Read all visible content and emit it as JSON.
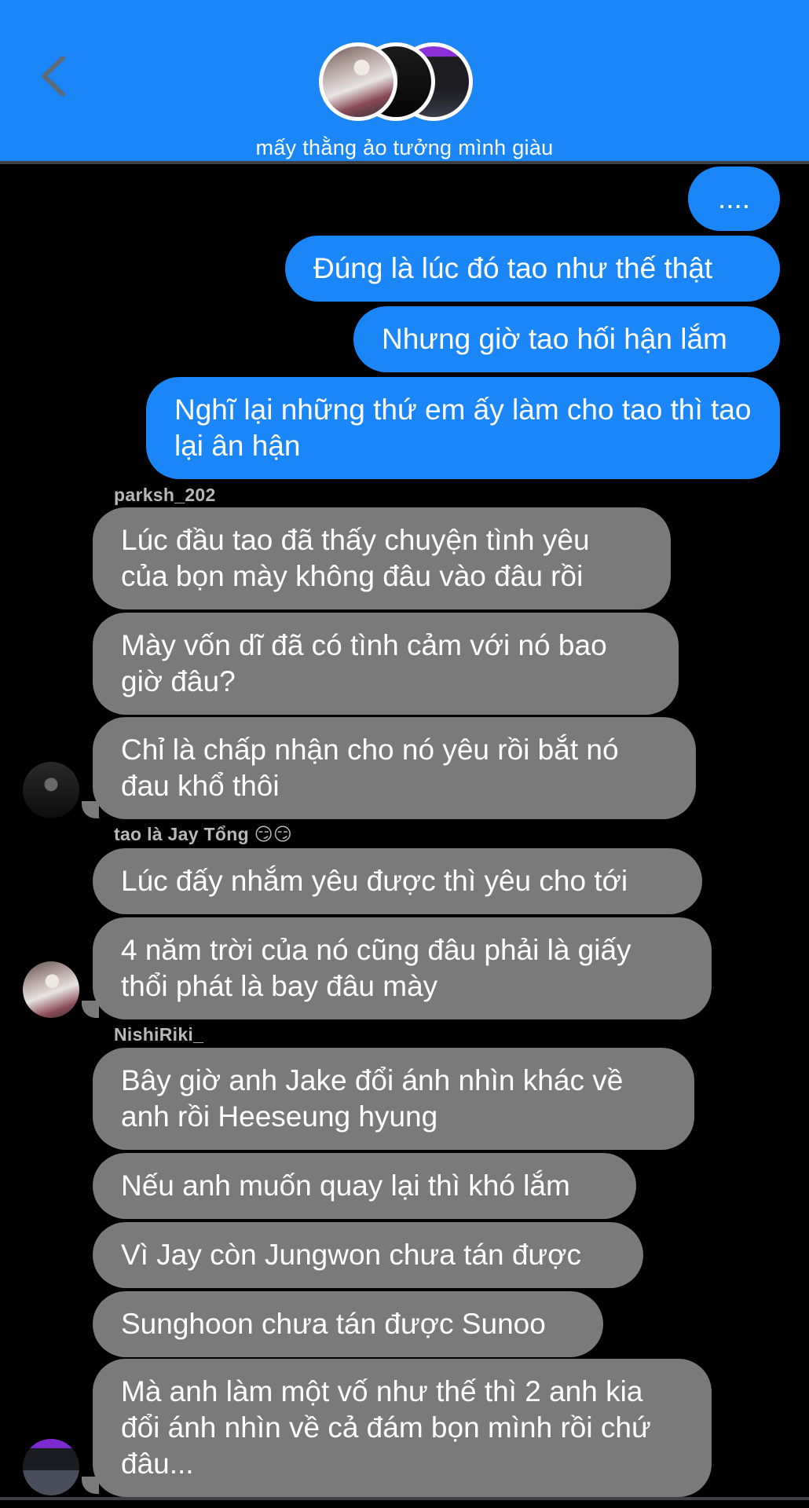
{
  "header": {
    "back_icon": "chevron-left-icon",
    "title": "mấy thằng ảo tưởng mình giàu",
    "accent_color": "#1a86f7"
  },
  "messages": {
    "outgoing": [
      "....",
      "Đúng là lúc đó tao như thế thật",
      "Nhưng giờ tao hối hận lắm",
      "Nghĩ lại những thứ em ấy làm cho tao thì tao lại ân hận"
    ],
    "group1": {
      "sender": "parksh_202",
      "bubbles": [
        "Lúc đầu tao đã thấy chuyện tình yêu của bọn mày không đâu vào đâu rồi",
        "Mày vốn dĩ đã có tình cảm với nó bao giờ đâu?",
        "Chỉ là chấp nhận cho nó yêu rồi bắt nó đau khổ thôi"
      ]
    },
    "group2": {
      "sender": "tao là Jay Tổng 😏😏",
      "bubbles": [
        "Lúc đấy nhắm yêu được thì yêu cho tới",
        "4 năm trời của nó cũng đâu phải là giấy thổi phát là bay đâu mày"
      ]
    },
    "group3": {
      "sender": "NishiRiki_",
      "bubbles": [
        "Bây giờ anh Jake đổi ánh nhìn khác về anh rồi Heeseung hyung",
        "Nếu anh muốn quay lại thì khó lắm",
        "Vì Jay còn Jungwon chưa tán được",
        "Sunghoon chưa tán được Sunoo",
        "Mà anh làm một vố như thế thì 2 anh kia đổi ánh nhìn về cả đám bọn mình rồi chứ đâu..."
      ]
    }
  },
  "colors": {
    "outgoing_bubble": "#1a86f7",
    "incoming_bubble": "#7a7a7a",
    "background": "#000000"
  }
}
